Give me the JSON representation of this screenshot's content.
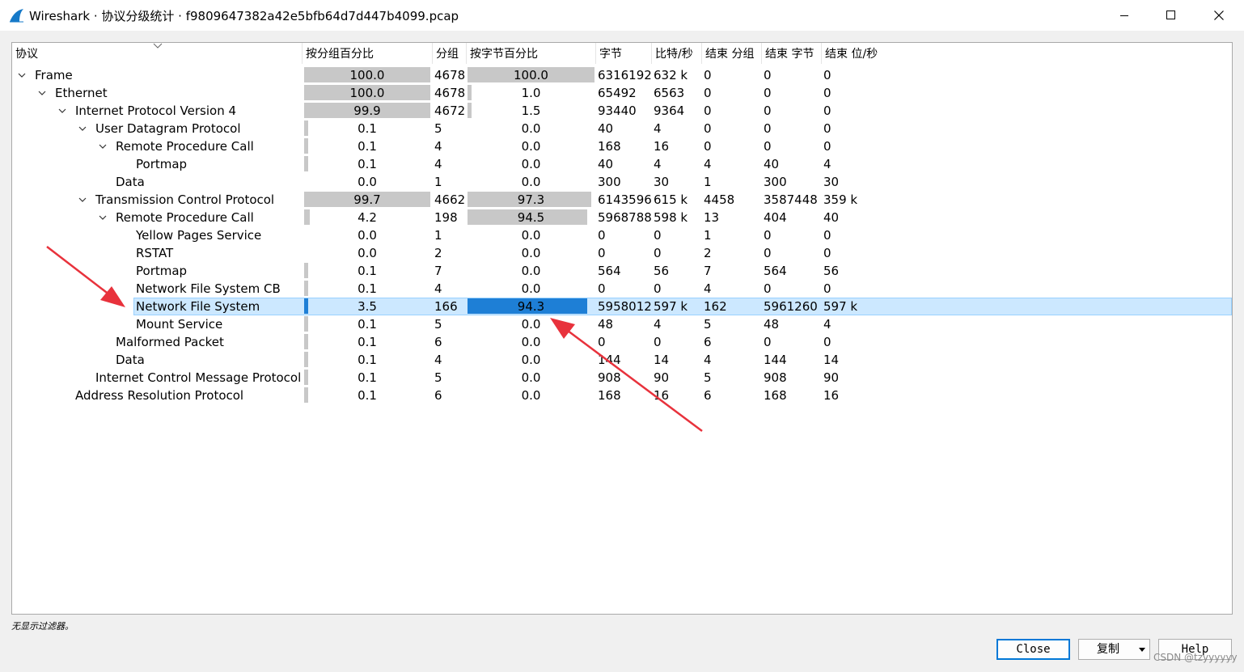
{
  "window": {
    "title": "Wireshark · 协议分级统计 · f9809647382a42e5bfb64d7d447b4099.pcap",
    "icon": "wireshark-fin-icon",
    "controls": [
      "minimize-icon",
      "maximize-icon",
      "close-icon"
    ]
  },
  "columns": [
    "协议",
    "按分组百分比",
    "分组",
    "按字节百分比",
    "字节",
    "比特/秒",
    "结束 分组",
    "结束 字节",
    "结束 位/秒"
  ],
  "rows": [
    {
      "protocol": "Frame",
      "depth": 0,
      "expander": "expanded",
      "pkt_pct": "100.0",
      "pkt_frac": 1.0,
      "packets": "4678",
      "byte_pct": "100.0",
      "byte_frac": 1.0,
      "bytes": "6316192",
      "bps": "632 k",
      "end_pkts": "0",
      "end_bytes": "0",
      "end_bps": "0"
    },
    {
      "protocol": "Ethernet",
      "depth": 1,
      "expander": "expanded",
      "pkt_pct": "100.0",
      "pkt_frac": 1.0,
      "packets": "4678",
      "byte_pct": "1.0",
      "byte_frac": 0.01,
      "bytes": "65492",
      "bps": "6563",
      "end_pkts": "0",
      "end_bytes": "0",
      "end_bps": "0"
    },
    {
      "protocol": "Internet Protocol Version 4",
      "depth": 2,
      "expander": "expanded",
      "pkt_pct": "99.9",
      "pkt_frac": 0.999,
      "packets": "4672",
      "byte_pct": "1.5",
      "byte_frac": 0.015,
      "bytes": "93440",
      "bps": "9364",
      "end_pkts": "0",
      "end_bytes": "0",
      "end_bps": "0"
    },
    {
      "protocol": "User Datagram Protocol",
      "depth": 3,
      "expander": "expanded",
      "pkt_pct": "0.1",
      "pkt_frac": 0.001,
      "packets": "5",
      "byte_pct": "0.0",
      "byte_frac": 0.0,
      "bytes": "40",
      "bps": "4",
      "end_pkts": "0",
      "end_bytes": "0",
      "end_bps": "0"
    },
    {
      "protocol": "Remote Procedure Call",
      "depth": 4,
      "expander": "expanded",
      "pkt_pct": "0.1",
      "pkt_frac": 0.001,
      "packets": "4",
      "byte_pct": "0.0",
      "byte_frac": 0.0,
      "bytes": "168",
      "bps": "16",
      "end_pkts": "0",
      "end_bytes": "0",
      "end_bps": "0"
    },
    {
      "protocol": "Portmap",
      "depth": 5,
      "expander": "none",
      "pkt_pct": "0.1",
      "pkt_frac": 0.001,
      "packets": "4",
      "byte_pct": "0.0",
      "byte_frac": 0.0,
      "bytes": "40",
      "bps": "4",
      "end_pkts": "4",
      "end_bytes": "40",
      "end_bps": "4"
    },
    {
      "protocol": "Data",
      "depth": 4,
      "expander": "none",
      "pkt_pct": "0.0",
      "pkt_frac": 0.0,
      "packets": "1",
      "byte_pct": "0.0",
      "byte_frac": 0.0,
      "bytes": "300",
      "bps": "30",
      "end_pkts": "1",
      "end_bytes": "300",
      "end_bps": "30"
    },
    {
      "protocol": "Transmission Control Protocol",
      "depth": 3,
      "expander": "expanded",
      "pkt_pct": "99.7",
      "pkt_frac": 0.997,
      "packets": "4662",
      "byte_pct": "97.3",
      "byte_frac": 0.973,
      "bytes": "6143596",
      "bps": "615 k",
      "end_pkts": "4458",
      "end_bytes": "3587448",
      "end_bps": "359 k"
    },
    {
      "protocol": "Remote Procedure Call",
      "depth": 4,
      "expander": "expanded",
      "pkt_pct": "4.2",
      "pkt_frac": 0.042,
      "packets": "198",
      "byte_pct": "94.5",
      "byte_frac": 0.945,
      "bytes": "5968788",
      "bps": "598 k",
      "end_pkts": "13",
      "end_bytes": "404",
      "end_bps": "40"
    },
    {
      "protocol": "Yellow Pages Service",
      "depth": 5,
      "expander": "none",
      "pkt_pct": "0.0",
      "pkt_frac": 0.0,
      "packets": "1",
      "byte_pct": "0.0",
      "byte_frac": 0.0,
      "bytes": "0",
      "bps": "0",
      "end_pkts": "1",
      "end_bytes": "0",
      "end_bps": "0"
    },
    {
      "protocol": "RSTAT",
      "depth": 5,
      "expander": "none",
      "pkt_pct": "0.0",
      "pkt_frac": 0.0,
      "packets": "2",
      "byte_pct": "0.0",
      "byte_frac": 0.0,
      "bytes": "0",
      "bps": "0",
      "end_pkts": "2",
      "end_bytes": "0",
      "end_bps": "0"
    },
    {
      "protocol": "Portmap",
      "depth": 5,
      "expander": "none",
      "pkt_pct": "0.1",
      "pkt_frac": 0.001,
      "packets": "7",
      "byte_pct": "0.0",
      "byte_frac": 0.0,
      "bytes": "564",
      "bps": "56",
      "end_pkts": "7",
      "end_bytes": "564",
      "end_bps": "56"
    },
    {
      "protocol": "Network File System CB",
      "depth": 5,
      "expander": "none",
      "pkt_pct": "0.1",
      "pkt_frac": 0.001,
      "packets": "4",
      "byte_pct": "0.0",
      "byte_frac": 0.0,
      "bytes": "0",
      "bps": "0",
      "end_pkts": "4",
      "end_bytes": "0",
      "end_bps": "0"
    },
    {
      "protocol": "Network File System",
      "depth": 5,
      "expander": "none",
      "selected": true,
      "pkt_pct": "3.5",
      "pkt_frac": 0.035,
      "packets": "166",
      "byte_pct": "94.3",
      "byte_frac": 0.943,
      "bytes": "5958012",
      "bps": "597 k",
      "end_pkts": "162",
      "end_bytes": "5961260",
      "end_bps": "597 k"
    },
    {
      "protocol": "Mount Service",
      "depth": 5,
      "expander": "none",
      "pkt_pct": "0.1",
      "pkt_frac": 0.001,
      "packets": "5",
      "byte_pct": "0.0",
      "byte_frac": 0.0,
      "bytes": "48",
      "bps": "4",
      "end_pkts": "5",
      "end_bytes": "48",
      "end_bps": "4"
    },
    {
      "protocol": "Malformed Packet",
      "depth": 4,
      "expander": "none",
      "pkt_pct": "0.1",
      "pkt_frac": 0.001,
      "packets": "6",
      "byte_pct": "0.0",
      "byte_frac": 0.0,
      "bytes": "0",
      "bps": "0",
      "end_pkts": "6",
      "end_bytes": "0",
      "end_bps": "0"
    },
    {
      "protocol": "Data",
      "depth": 4,
      "expander": "none",
      "pkt_pct": "0.1",
      "pkt_frac": 0.001,
      "packets": "4",
      "byte_pct": "0.0",
      "byte_frac": 0.0,
      "bytes": "144",
      "bps": "14",
      "end_pkts": "4",
      "end_bytes": "144",
      "end_bps": "14"
    },
    {
      "protocol": "Internet Control Message Protocol",
      "depth": 3,
      "expander": "none",
      "pkt_pct": "0.1",
      "pkt_frac": 0.001,
      "packets": "5",
      "byte_pct": "0.0",
      "byte_frac": 0.0,
      "bytes": "908",
      "bps": "90",
      "end_pkts": "5",
      "end_bytes": "908",
      "end_bps": "90"
    },
    {
      "protocol": "Address Resolution Protocol",
      "depth": 2,
      "expander": "none",
      "pkt_pct": "0.1",
      "pkt_frac": 0.001,
      "packets": "6",
      "byte_pct": "0.0",
      "byte_frac": 0.0,
      "bytes": "168",
      "bps": "16",
      "end_pkts": "6",
      "end_bytes": "168",
      "end_bps": "16"
    }
  ],
  "status": {
    "text": "无显示过滤器。"
  },
  "buttons": {
    "close": "Close",
    "copy": "复制",
    "help": "Help"
  },
  "watermark": "CSDN @tzyyyyyy",
  "colors": {
    "bar": "#c8c8c8",
    "bar_selected": "#1e7fd6",
    "row_selected": "#cce8ff",
    "annotation_arrow": "#e8323c"
  }
}
